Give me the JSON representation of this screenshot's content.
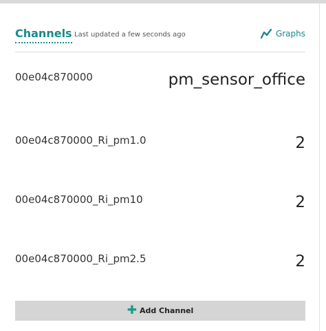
{
  "header": {
    "title": "Channels",
    "updated": "Last updated a few seconds ago",
    "graphs_label": "Graphs",
    "graphs_icon": "line-chart-icon"
  },
  "channels": [
    {
      "name": "00e04c870000",
      "value": "pm_sensor_office"
    },
    {
      "name": "00e04c870000_Ri_pm1.0",
      "value": "2"
    },
    {
      "name": "00e04c870000_Ri_pm10",
      "value": "2"
    },
    {
      "name": "00e04c870000_Ri_pm2.5",
      "value": "2"
    }
  ],
  "add_button": {
    "label": "Add Channel",
    "icon": "plus-icon"
  },
  "colors": {
    "accent": "#1a8a8a",
    "button_bg": "#d5d5d5"
  }
}
